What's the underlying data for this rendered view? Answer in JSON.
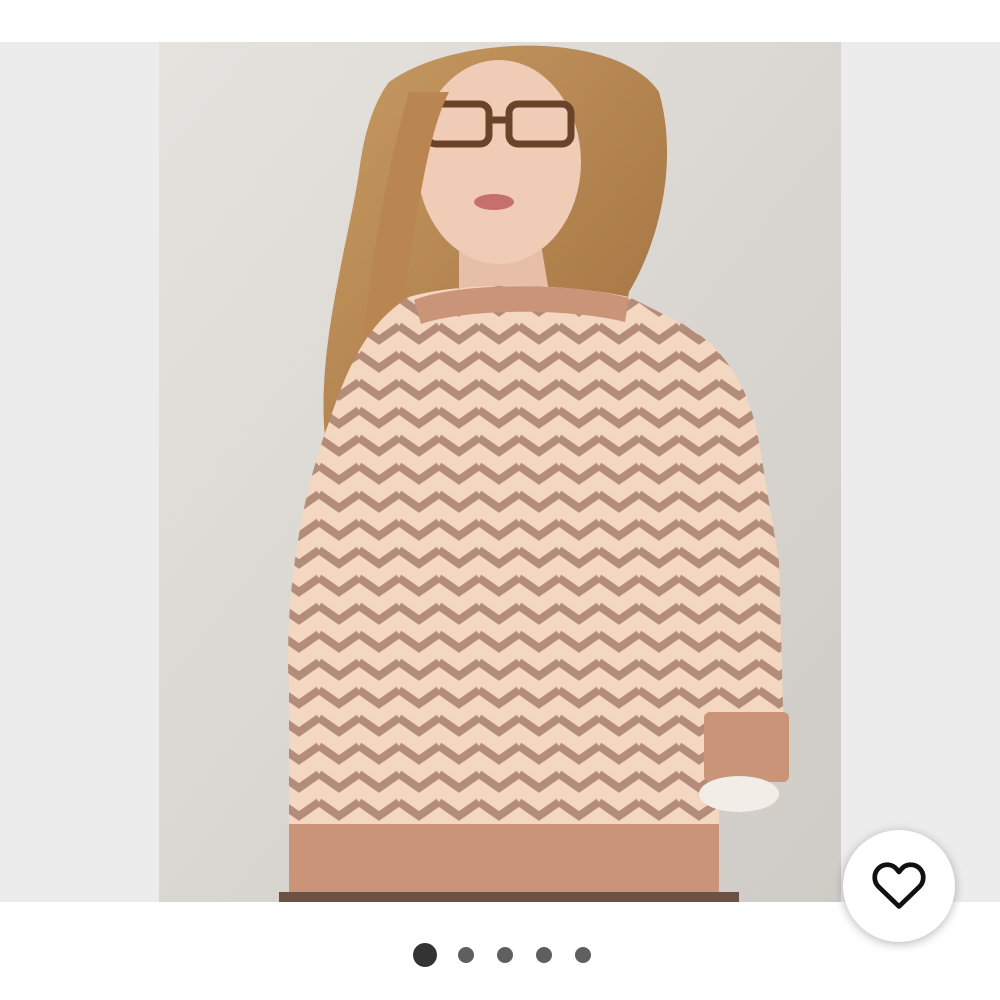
{
  "gallery": {
    "slide_count": 5,
    "active_slide": 1
  },
  "icons": {
    "like": "heart-outline-icon"
  },
  "colors": {
    "gallery_background": "#ececec",
    "dot": "#5f5f5f",
    "dot_active": "#333333",
    "sweater_light": "#f4d7c0",
    "sweater_dark": "#b48c7a",
    "sweater_trim": "#c99478"
  }
}
